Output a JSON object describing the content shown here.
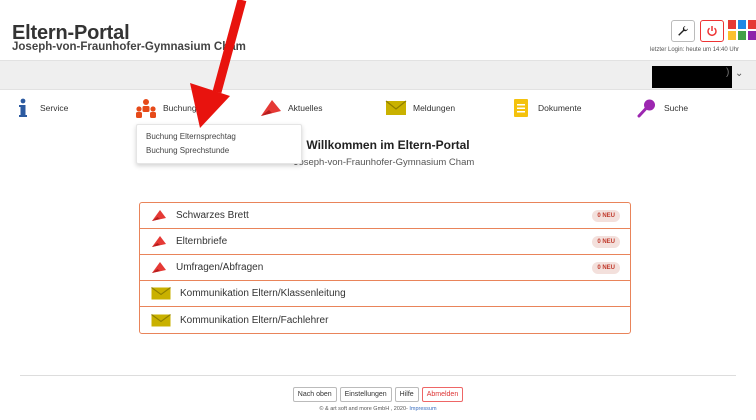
{
  "header": {
    "title": "Eltern-Portal",
    "school": "Joseph-von-Fraunhofer-Gymnasium Cham",
    "last_login": "letzter Login: heute um 14:40 Uhr",
    "wrench_icon": "wrench-icon",
    "power_icon": "power-icon",
    "apps_icon": "apps-grid-icon",
    "apps_colors": [
      "#e53935",
      "#1e88e5",
      "#e53935",
      "#fbc02d",
      "#43a047",
      "#8e24aa"
    ]
  },
  "user_bar": {
    "chevron": "⌄",
    "paren": ")"
  },
  "nav": {
    "items": [
      {
        "label": "Service",
        "icon": "info-icon"
      },
      {
        "label": "Buchung",
        "icon": "people-icon"
      },
      {
        "label": "Aktuelles",
        "icon": "megaphone-icon"
      },
      {
        "label": "Meldungen",
        "icon": "envelope-icon"
      },
      {
        "label": "Dokumente",
        "icon": "document-icon"
      },
      {
        "label": "Suche",
        "icon": "search-icon"
      }
    ]
  },
  "dropdown": {
    "items": [
      "Buchung Elternsprechtag",
      "Buchung Sprechstunde"
    ]
  },
  "main": {
    "welcome": "Willkommen im Eltern-Portal",
    "subtitle": "Joseph-von-Fraunhofer-Gymnasium Cham",
    "menu": [
      {
        "label": "Schwarzes Brett",
        "icon": "megaphone-icon",
        "badge": "0 NEU"
      },
      {
        "label": "Elternbriefe",
        "icon": "megaphone-icon",
        "badge": "0 NEU"
      },
      {
        "label": "Umfragen/Abfragen",
        "icon": "megaphone-icon",
        "badge": "0 NEU"
      },
      {
        "label": "Kommunikation Eltern/Klassenleitung",
        "icon": "envelope-icon",
        "badge": ""
      },
      {
        "label": "Kommunikation Eltern/Fachlehrer",
        "icon": "envelope-icon",
        "badge": ""
      }
    ]
  },
  "footer": {
    "buttons": [
      "Nach oben",
      "Einstellungen",
      "Hilfe",
      "Abmelden"
    ],
    "copyright": "© & art soft and more GmbH , 2020-",
    "impressum": "Impressum"
  },
  "colors": {
    "accent_red": "#e53935",
    "border_orange": "#e9845a",
    "envelope": "#c9b100"
  }
}
